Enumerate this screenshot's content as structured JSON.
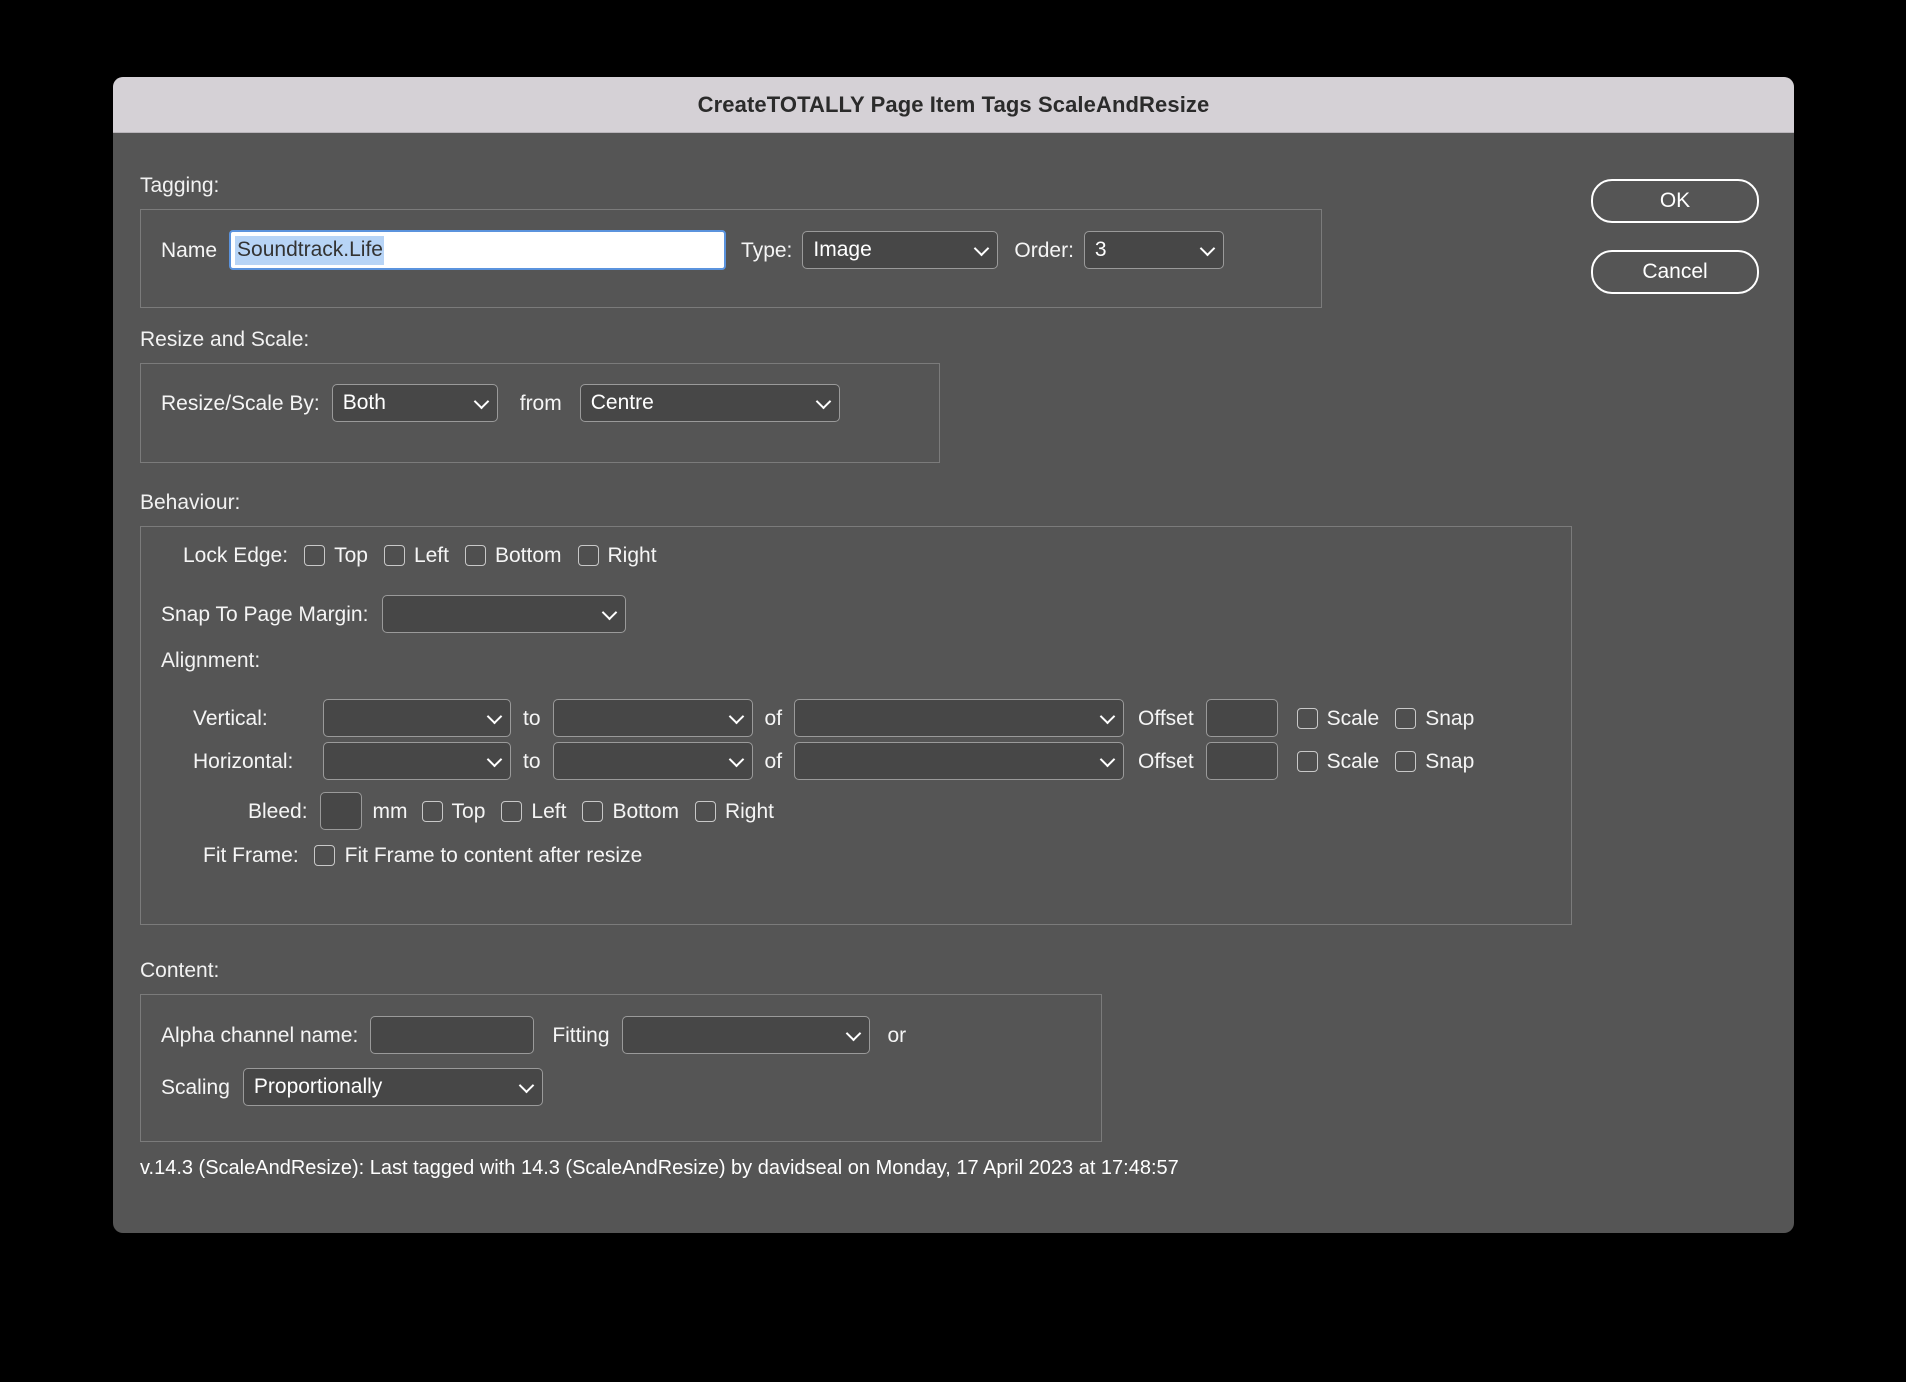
{
  "window": {
    "title": "CreateTOTALLY Page Item Tags ScaleAndResize"
  },
  "buttons": {
    "ok": "OK",
    "cancel": "Cancel"
  },
  "tagging": {
    "section_label": "Tagging:",
    "name_label": "Name",
    "name_value": "Soundtrack.Life",
    "type_label": "Type:",
    "type_value": "Image",
    "order_label": "Order:",
    "order_value": "3"
  },
  "resize_and_scale": {
    "section_label": "Resize and Scale:",
    "resize_scale_by_label": "Resize/Scale By:",
    "resize_scale_by_value": "Both",
    "from_label": "from",
    "from_value": "Centre"
  },
  "behaviour": {
    "section_label": "Behaviour:",
    "lock_edge_label": "Lock Edge:",
    "lock_edge_options": [
      "Top",
      "Left",
      "Bottom",
      "Right"
    ],
    "snap_to_page_margin_label": "Snap To Page Margin:",
    "snap_to_page_margin_value": "",
    "alignment_label": "Alignment:",
    "vertical_label": "Vertical:",
    "horizontal_label": "Horizontal:",
    "to_label": "to",
    "of_label": "of",
    "offset_label": "Offset",
    "scale_label": "Scale",
    "snap_label": "Snap",
    "vertical_align_value": "",
    "vertical_to_value": "",
    "vertical_of_value": "",
    "vertical_offset_value": "",
    "horizontal_align_value": "",
    "horizontal_to_value": "",
    "horizontal_of_value": "",
    "horizontal_offset_value": "",
    "bleed_label": "Bleed:",
    "bleed_value": "",
    "bleed_unit": "mm",
    "bleed_options": [
      "Top",
      "Left",
      "Bottom",
      "Right"
    ],
    "fit_frame_label": "Fit Frame:",
    "fit_frame_checkbox_label": "Fit Frame to content after resize"
  },
  "content": {
    "section_label": "Content:",
    "alpha_channel_label": "Alpha channel name:",
    "alpha_channel_value": "",
    "fitting_label": "Fitting",
    "fitting_value": "",
    "or_label": "or",
    "scaling_label": "Scaling",
    "scaling_value": "Proportionally"
  },
  "status": {
    "text": "v.14.3 (ScaleAndResize):   Last tagged with 14.3 (ScaleAndResize) by davidseal  on Monday, 17 April 2023 at 17:48:57"
  },
  "colors": {
    "titlebar": "#d5d1d6",
    "dialog_body": "#555555",
    "control_fill": "#474747",
    "control_border": "#9a9a9a",
    "selection_highlight": "#b7d4f6",
    "focus_border": "#5b93dd"
  }
}
